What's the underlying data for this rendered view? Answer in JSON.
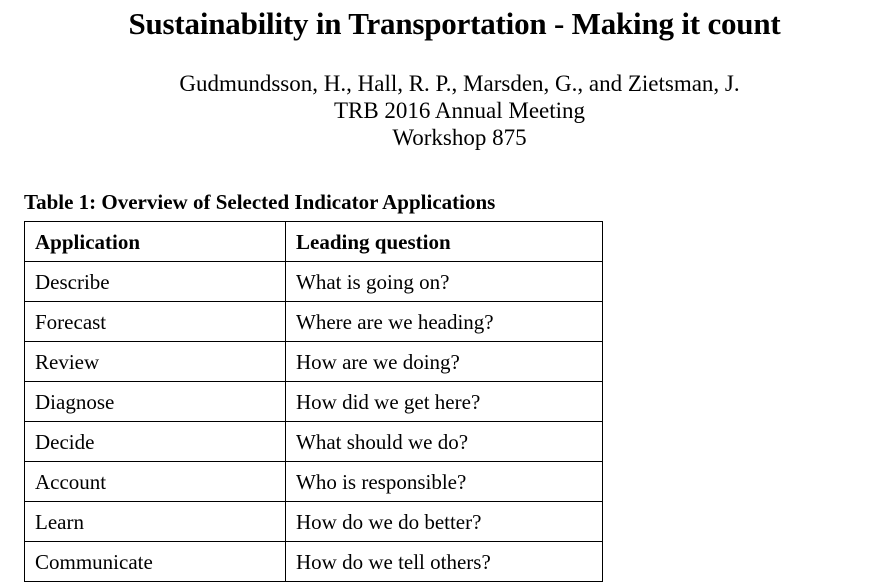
{
  "document": {
    "title": "Sustainability in Transportation - Making it count",
    "authors": "Gudmundsson, H., Hall, R. P., Marsden, G., and Zietsman, J.",
    "event": "TRB 2016 Annual Meeting",
    "session": "Workshop 875"
  },
  "table": {
    "caption": "Table 1: Overview of Selected Indicator Applications",
    "columns": [
      {
        "label": "Application"
      },
      {
        "label": "Leading question"
      }
    ],
    "rows": [
      {
        "application": "Describe",
        "question": "What is going on?"
      },
      {
        "application": "Forecast",
        "question": "Where are we heading?"
      },
      {
        "application": "Review",
        "question": "How are we doing?"
      },
      {
        "application": "Diagnose",
        "question": "How did we get here?"
      },
      {
        "application": "Decide",
        "question": "What should we do?"
      },
      {
        "application": "Account",
        "question": "Who is responsible?"
      },
      {
        "application": "Learn",
        "question": "How do we do better?"
      },
      {
        "application": "Communicate",
        "question": "How do we tell others?"
      }
    ]
  },
  "colors": {
    "background": "#ffffff",
    "text": "#000000",
    "border": "#000000"
  }
}
